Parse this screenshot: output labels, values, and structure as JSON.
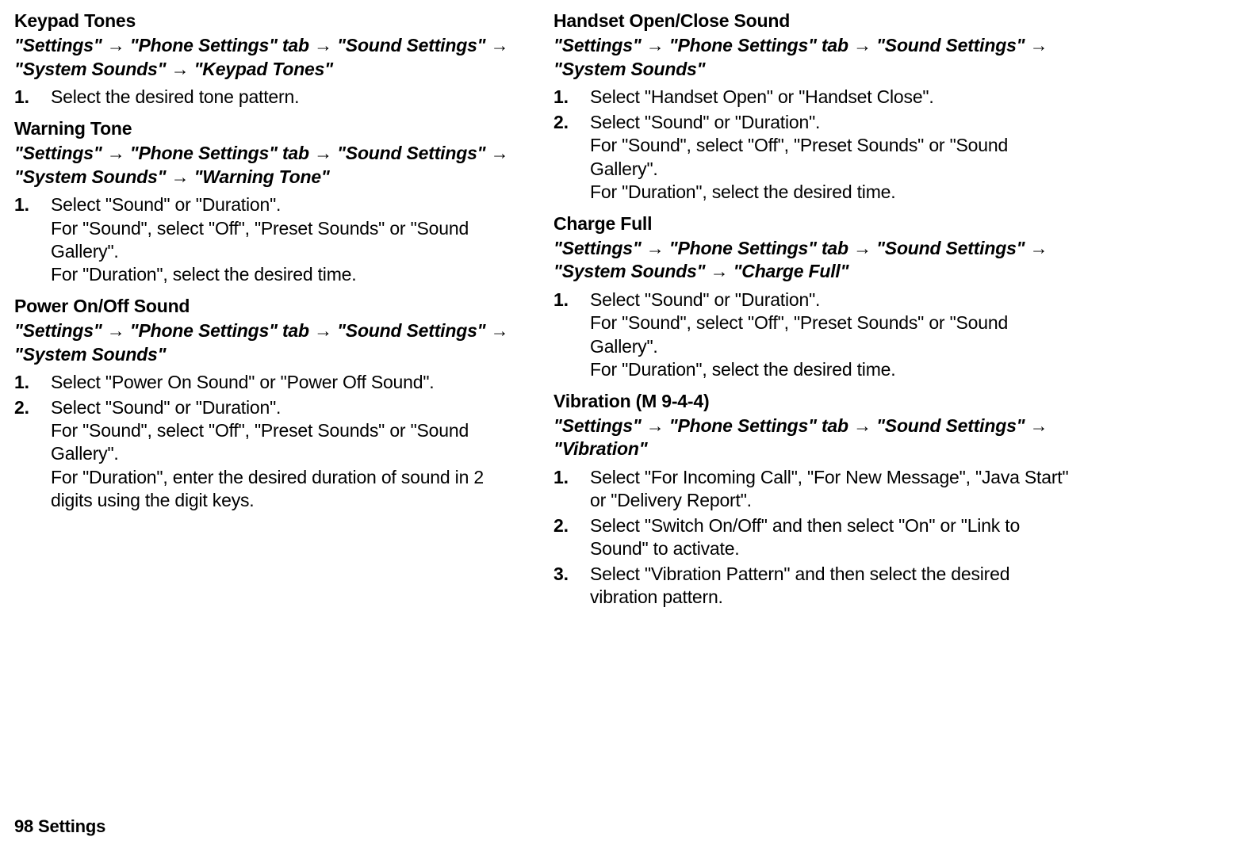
{
  "arrow": "→",
  "page_footer": "98    Settings",
  "left": {
    "keypad_tones": {
      "title": "Keypad Tones",
      "path": [
        "\"Settings\"",
        "\"Phone Settings\" tab",
        "\"Sound Settings\"",
        "\"System Sounds\"",
        "\"Keypad Tones\""
      ],
      "steps": [
        {
          "num": "1.",
          "text": "Select the desired tone pattern."
        }
      ]
    },
    "warning_tone": {
      "title": "Warning Tone",
      "path": [
        "\"Settings\"",
        "\"Phone Settings\" tab",
        "\"Sound Settings\"",
        "\"System Sounds\"",
        "\"Warning Tone\""
      ],
      "steps": [
        {
          "num": "1.",
          "text": "Select \"Sound\" or \"Duration\".",
          "subs": [
            "For \"Sound\", select \"Off\", \"Preset Sounds\" or \"Sound Gallery\".",
            "For \"Duration\", select the desired time."
          ]
        }
      ]
    },
    "power_onoff": {
      "title": "Power On/Off Sound",
      "path": [
        "\"Settings\"",
        "\"Phone Settings\" tab",
        "\"Sound Settings\"",
        "\"System Sounds\""
      ],
      "steps": [
        {
          "num": "1.",
          "text": "Select \"Power On Sound\" or \"Power Off Sound\"."
        },
        {
          "num": "2.",
          "text": "Select \"Sound\" or \"Duration\".",
          "subs": [
            "For \"Sound\", select \"Off\", \"Preset Sounds\" or \"Sound Gallery\".",
            "For \"Duration\", enter the desired duration of sound in 2 digits using the digit keys."
          ]
        }
      ]
    }
  },
  "right": {
    "handset_openclose": {
      "title": "Handset Open/Close Sound",
      "path": [
        "\"Settings\"",
        "\"Phone Settings\" tab",
        "\"Sound Settings\"",
        "\"System Sounds\""
      ],
      "steps": [
        {
          "num": "1.",
          "text": "Select \"Handset Open\" or \"Handset Close\"."
        },
        {
          "num": "2.",
          "text": "Select \"Sound\" or \"Duration\".",
          "subs": [
            "For \"Sound\", select \"Off\", \"Preset Sounds\" or \"Sound Gallery\".",
            "For \"Duration\", select the desired time."
          ]
        }
      ]
    },
    "charge_full": {
      "title": "Charge Full",
      "path": [
        "\"Settings\"",
        "\"Phone Settings\" tab",
        "\"Sound Settings\"",
        "\"System Sounds\"",
        "\"Charge Full\""
      ],
      "steps": [
        {
          "num": "1.",
          "text": "Select \"Sound\" or \"Duration\".",
          "subs": [
            "For \"Sound\", select \"Off\", \"Preset Sounds\" or \"Sound Gallery\".",
            "For \"Duration\", select the desired time."
          ]
        }
      ]
    },
    "vibration": {
      "title": "Vibration (M 9-4-4)",
      "path": [
        "\"Settings\"",
        "\"Phone Settings\" tab",
        "\"Sound Settings\"",
        "\"Vibration\""
      ],
      "steps": [
        {
          "num": "1.",
          "text": "Select \"For Incoming Call\", \"For New Message\", \"Java Start\" or \"Delivery Report\"."
        },
        {
          "num": "2.",
          "text": "Select \"Switch On/Off\" and then select \"On\" or \"Link to Sound\" to activate."
        },
        {
          "num": "3.",
          "text": "Select \"Vibration Pattern\" and then select the desired vibration pattern."
        }
      ]
    }
  }
}
